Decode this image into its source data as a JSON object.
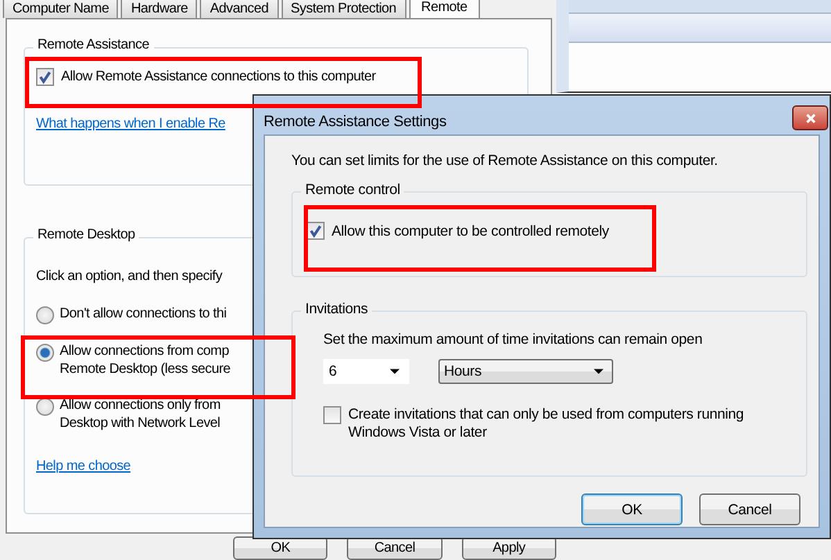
{
  "system_properties": {
    "tabs": [
      {
        "label": "Computer Name",
        "selected": false
      },
      {
        "label": "Hardware",
        "selected": false
      },
      {
        "label": "Advanced",
        "selected": false
      },
      {
        "label": "System Protection",
        "selected": false
      },
      {
        "label": "Remote",
        "selected": true
      }
    ],
    "remote_assistance": {
      "title": "Remote Assistance",
      "checkbox": {
        "label": "Allow Remote Assistance connections to this computer",
        "checked": true
      },
      "link": "What happens when I enable Re"
    },
    "remote_desktop": {
      "title": "Remote Desktop",
      "instruction": "Click an option, and then specify",
      "options": [
        {
          "lines": [
            "Don't allow connections to thi"
          ],
          "selected": false
        },
        {
          "lines": [
            "Allow connections from comp",
            "Remote Desktop (less secure"
          ],
          "selected": true
        },
        {
          "lines": [
            "Allow connections only from",
            "Desktop with Network Level"
          ],
          "selected": false
        }
      ],
      "link": "Help me choose"
    },
    "buttons": [
      "OK",
      "Cancel",
      "Apply"
    ]
  },
  "dialog": {
    "title": "Remote Assistance Settings",
    "intro": "You can set limits for the use of Remote Assistance on this computer.",
    "remote_control": {
      "title": "Remote control",
      "checkbox": {
        "label": "Allow this computer to be controlled remotely",
        "checked": true
      }
    },
    "invitations": {
      "title": "Invitations",
      "instruction": "Set the maximum amount of time invitations can remain open",
      "duration": {
        "value": "6"
      },
      "unit": {
        "value": "Hours"
      },
      "checkbox": {
        "label": "Create invitations that can only be used from computers running Windows Vista or later",
        "checked": false
      }
    },
    "buttons": [
      {
        "label": "OK",
        "default": true
      },
      {
        "label": "Cancel",
        "default": false
      }
    ]
  }
}
